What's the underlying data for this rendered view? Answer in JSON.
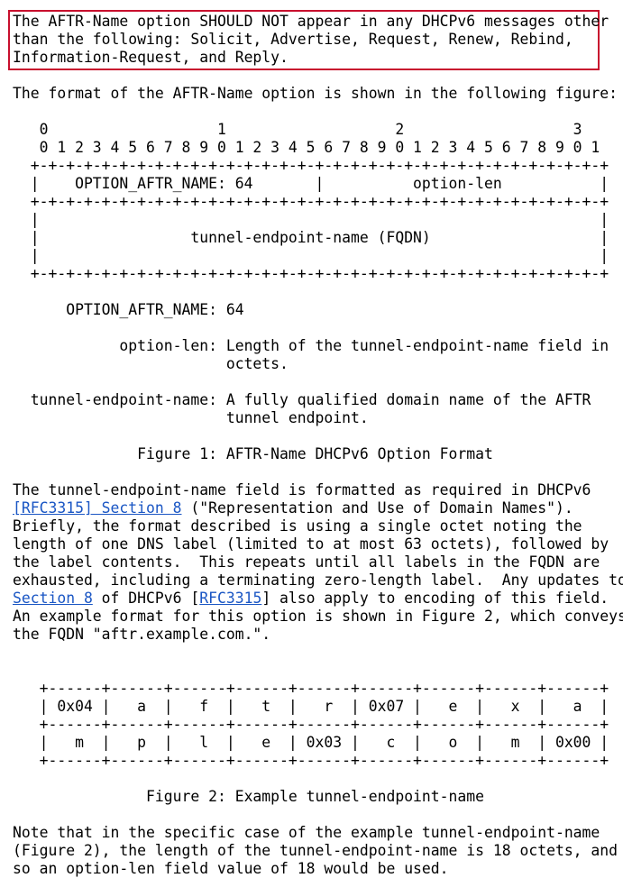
{
  "colors": {
    "highlight": "#c8102e",
    "link": "#1a56c4",
    "text": "#000000"
  },
  "lines": [
    [
      {
        "t": "The AFTR-Name option SHOULD NOT appear in any DHCPv6 messages other"
      }
    ],
    [
      {
        "t": "than the following: Solicit, Advertise, Request, Renew, Rebind,"
      }
    ],
    [
      {
        "t": "Information-Request, and Reply."
      }
    ],
    [],
    [
      {
        "t": "The format of the AFTR-Name option is shown in the following figure:"
      }
    ],
    [],
    [
      {
        "t": "   0                   1                   2                   3"
      }
    ],
    [
      {
        "t": "   0 1 2 3 4 5 6 7 8 9 0 1 2 3 4 5 6 7 8 9 0 1 2 3 4 5 6 7 8 9 0 1"
      }
    ],
    [
      {
        "t": "  +-+-+-+-+-+-+-+-+-+-+-+-+-+-+-+-+-+-+-+-+-+-+-+-+-+-+-+-+-+-+-+-+"
      }
    ],
    [
      {
        "t": "  |    OPTION_AFTR_NAME: 64       |          option-len           |"
      }
    ],
    [
      {
        "t": "  +-+-+-+-+-+-+-+-+-+-+-+-+-+-+-+-+-+-+-+-+-+-+-+-+-+-+-+-+-+-+-+-+"
      }
    ],
    [
      {
        "t": "  |                                                               |"
      }
    ],
    [
      {
        "t": "  |                 tunnel-endpoint-name (FQDN)                   |"
      }
    ],
    [
      {
        "t": "  |                                                               |"
      }
    ],
    [
      {
        "t": "  +-+-+-+-+-+-+-+-+-+-+-+-+-+-+-+-+-+-+-+-+-+-+-+-+-+-+-+-+-+-+-+-+"
      }
    ],
    [],
    [
      {
        "t": "      OPTION_AFTR_NAME: 64"
      }
    ],
    [],
    [
      {
        "t": "            option-len: Length of the tunnel-endpoint-name field in"
      }
    ],
    [
      {
        "t": "                        octets."
      }
    ],
    [],
    [
      {
        "t": "  tunnel-endpoint-name: A fully qualified domain name of the AFTR"
      }
    ],
    [
      {
        "t": "                        tunnel endpoint."
      }
    ],
    [],
    [
      {
        "t": "              Figure 1: AFTR-Name DHCPv6 Option Format"
      }
    ],
    [],
    [
      {
        "t": "The tunnel-endpoint-name field is formatted as required in DHCPv6"
      }
    ],
    [
      {
        "t": "[RFC3315] Section 8",
        "link": true
      },
      {
        "t": " (\"Representation and Use of Domain Names\")."
      }
    ],
    [
      {
        "t": "Briefly, the format described is using a single octet noting the"
      }
    ],
    [
      {
        "t": "length of one DNS label (limited to at most 63 octets), followed by"
      }
    ],
    [
      {
        "t": "the label contents.  This repeats until all labels in the FQDN are"
      }
    ],
    [
      {
        "t": "exhausted, including a terminating zero-length label.  Any updates to"
      }
    ],
    [
      {
        "t": "Section 8",
        "link": true
      },
      {
        "t": " of DHCPv6 ["
      },
      {
        "t": "RFC3315",
        "link": true
      },
      {
        "t": "] also apply to encoding of this field."
      }
    ],
    [
      {
        "t": "An example format for this option is shown in Figure 2, which conveys"
      }
    ],
    [
      {
        "t": "the FQDN \"aftr.example.com.\"."
      }
    ],
    [],
    [],
    [
      {
        "t": "   +------+------+------+------+------+------+------+------+------+"
      }
    ],
    [
      {
        "t": "   | 0x04 |   a  |   f  |   t  |   r  | 0x07 |   e  |   x  |   a  |"
      }
    ],
    [
      {
        "t": "   +------+------+------+------+------+------+------+------+------+"
      }
    ],
    [
      {
        "t": "   |   m  |   p  |   l  |   e  | 0x03 |   c  |   o  |   m  | 0x00 |"
      }
    ],
    [
      {
        "t": "   +------+------+------+------+------+------+------+------+------+"
      }
    ],
    [],
    [
      {
        "t": "               Figure 2: Example tunnel-endpoint-name"
      }
    ],
    [],
    [
      {
        "t": "Note that in the specific case of the example tunnel-endpoint-name"
      }
    ],
    [
      {
        "t": "(Figure 2), the length of the tunnel-endpoint-name is 18 octets, and"
      }
    ],
    [
      {
        "t": "so an option-len field value of 18 would be used."
      }
    ]
  ]
}
